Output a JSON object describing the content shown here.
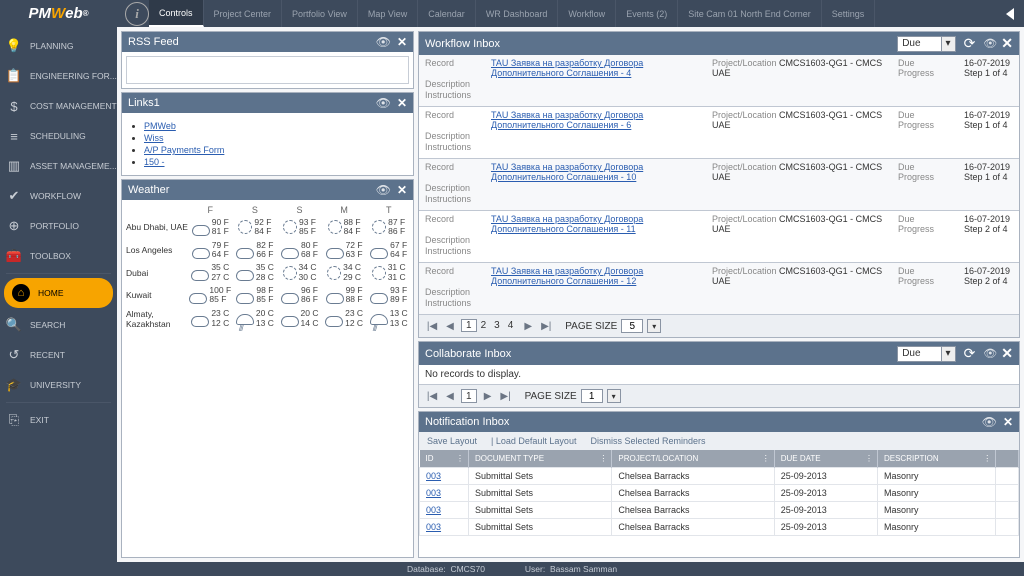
{
  "logo": {
    "pre": "PM",
    "mid": "W",
    "post": "eb"
  },
  "topTabs": [
    "Controls",
    "Project Center",
    "Portfolio View",
    "Map View",
    "Calendar",
    "WR Dashboard",
    "Workflow",
    "Events (2)",
    "Site Cam 01 North End Corner",
    "Settings"
  ],
  "activeTabIndex": 0,
  "sidebar": [
    {
      "label": "PLANNING"
    },
    {
      "label": "ENGINEERING FOR..."
    },
    {
      "label": "COST MANAGEMENT"
    },
    {
      "label": "SCHEDULING"
    },
    {
      "label": "ASSET MANAGEME..."
    },
    {
      "label": "WORKFLOW"
    },
    {
      "label": "PORTFOLIO"
    },
    {
      "label": "TOOLBOX"
    },
    {
      "label": "HOME"
    },
    {
      "label": "SEARCH"
    },
    {
      "label": "RECENT"
    },
    {
      "label": "UNIVERSITY"
    },
    {
      "label": "EXIT"
    }
  ],
  "panels": {
    "rss": {
      "title": "RSS Feed"
    },
    "links": {
      "title": "Links1",
      "items": [
        "PMWeb",
        "Wiss",
        "A/P Payments Form",
        "150 -"
      ]
    },
    "weather": {
      "title": "Weather",
      "days": [
        "F",
        "S",
        "S",
        "M",
        "T"
      ],
      "rows": [
        {
          "city": "Abu Dhabi, UAE",
          "cells": [
            {
              "i": "cloud",
              "h": "90 F",
              "l": "81 F"
            },
            {
              "i": "sun",
              "h": "92 F",
              "l": "84 F"
            },
            {
              "i": "sun",
              "h": "93 F",
              "l": "85 F"
            },
            {
              "i": "sun",
              "h": "88 F",
              "l": "84 F"
            },
            {
              "i": "sun",
              "h": "87 F",
              "l": "86 F"
            }
          ]
        },
        {
          "city": "Los Angeles",
          "cells": [
            {
              "i": "cloud",
              "h": "79 F",
              "l": "64 F"
            },
            {
              "i": "cloud",
              "h": "82 F",
              "l": "66 F"
            },
            {
              "i": "cloud",
              "h": "80 F",
              "l": "68 F"
            },
            {
              "i": "cloud",
              "h": "72 F",
              "l": "63 F"
            },
            {
              "i": "cloud",
              "h": "67 F",
              "l": "64 F"
            }
          ]
        },
        {
          "city": "Dubai",
          "cells": [
            {
              "i": "cloud",
              "h": "35 C",
              "l": "27 C"
            },
            {
              "i": "cloud",
              "h": "35 C",
              "l": "28 C"
            },
            {
              "i": "sun",
              "h": "34 C",
              "l": "30 C"
            },
            {
              "i": "sun",
              "h": "34 C",
              "l": "29 C"
            },
            {
              "i": "sun",
              "h": "31 C",
              "l": "31 C"
            }
          ]
        },
        {
          "city": "Kuwait",
          "cells": [
            {
              "i": "cloud",
              "h": "100 F",
              "l": "85 F"
            },
            {
              "i": "cloud",
              "h": "98 F",
              "l": "85 F"
            },
            {
              "i": "cloud",
              "h": "96 F",
              "l": "86 F"
            },
            {
              "i": "cloud",
              "h": "99 F",
              "l": "88 F"
            },
            {
              "i": "cloud",
              "h": "93 F",
              "l": "89 F"
            }
          ]
        },
        {
          "city": "Almaty, Kazakhstan",
          "cells": [
            {
              "i": "cloud",
              "h": "23 C",
              "l": "12 C"
            },
            {
              "i": "rain",
              "h": "20 C",
              "l": "13 C"
            },
            {
              "i": "cloud",
              "h": "20 C",
              "l": "14 C"
            },
            {
              "i": "cloud",
              "h": "23 C",
              "l": "12 C"
            },
            {
              "i": "rain",
              "h": "13 C",
              "l": "13 C"
            }
          ]
        }
      ]
    },
    "workflow": {
      "title": "Workflow Inbox",
      "select": "Due",
      "labels": {
        "record": "Record",
        "desc": "Description",
        "instr": "Instructions",
        "proj": "Project/Location",
        "due": "Due",
        "prog": "Progress"
      },
      "projectLocation": "CMCS1603-QG1 - CMCS UAE",
      "dueDate": "16-07-2019",
      "items": [
        {
          "link": "TAU Заявка на разработку Договора Дополнительного Соглашения - 4",
          "progress": "Step 1 of 4"
        },
        {
          "link": "TAU Заявка на разработку Договора Дополнительного Соглашения - 6",
          "progress": "Step 1 of 4"
        },
        {
          "link": "TAU Заявка на разработку Договора Дополнительного Соглашения - 10",
          "progress": "Step 1 of 4"
        },
        {
          "link": "TAU Заявка на разработку Договора Дополнительного Соглашения - 11",
          "progress": "Step 2 of 4"
        },
        {
          "link": "TAU Заявка на разработку Договора Дополнительного Соглашения - 12",
          "progress": "Step 2 of 4"
        }
      ],
      "pages": [
        "1",
        "2",
        "3",
        "4"
      ],
      "pageSizeLabel": "PAGE SIZE",
      "pageSize": "5"
    },
    "collab": {
      "title": "Collaborate Inbox",
      "select": "Due",
      "empty": "No records to display.",
      "pageSizeLabel": "PAGE SIZE",
      "pageSize": "1"
    },
    "notify": {
      "title": "Notification Inbox",
      "tools": [
        "Save Layout",
        "|  Load Default Layout",
        "Dismiss Selected Reminders"
      ],
      "cols": [
        "ID",
        "DOCUMENT TYPE",
        "PROJECT/LOCATION",
        "DUE DATE",
        "DESCRIPTION"
      ],
      "rows": [
        {
          "id": "003",
          "doc": "Submittal Sets",
          "proj": "Chelsea Barracks",
          "due": "25-09-2013",
          "desc": "Masonry"
        },
        {
          "id": "003",
          "doc": "Submittal Sets",
          "proj": "Chelsea Barracks",
          "due": "25-09-2013",
          "desc": "Masonry"
        },
        {
          "id": "003",
          "doc": "Submittal Sets",
          "proj": "Chelsea Barracks",
          "due": "25-09-2013",
          "desc": "Masonry"
        },
        {
          "id": "003",
          "doc": "Submittal Sets",
          "proj": "Chelsea Barracks",
          "due": "25-09-2013",
          "desc": "Masonry"
        }
      ]
    }
  },
  "status": {
    "dbLabel": "Database:",
    "db": "CMCS70",
    "userLabel": "User:",
    "user": "Bassam Samman"
  }
}
